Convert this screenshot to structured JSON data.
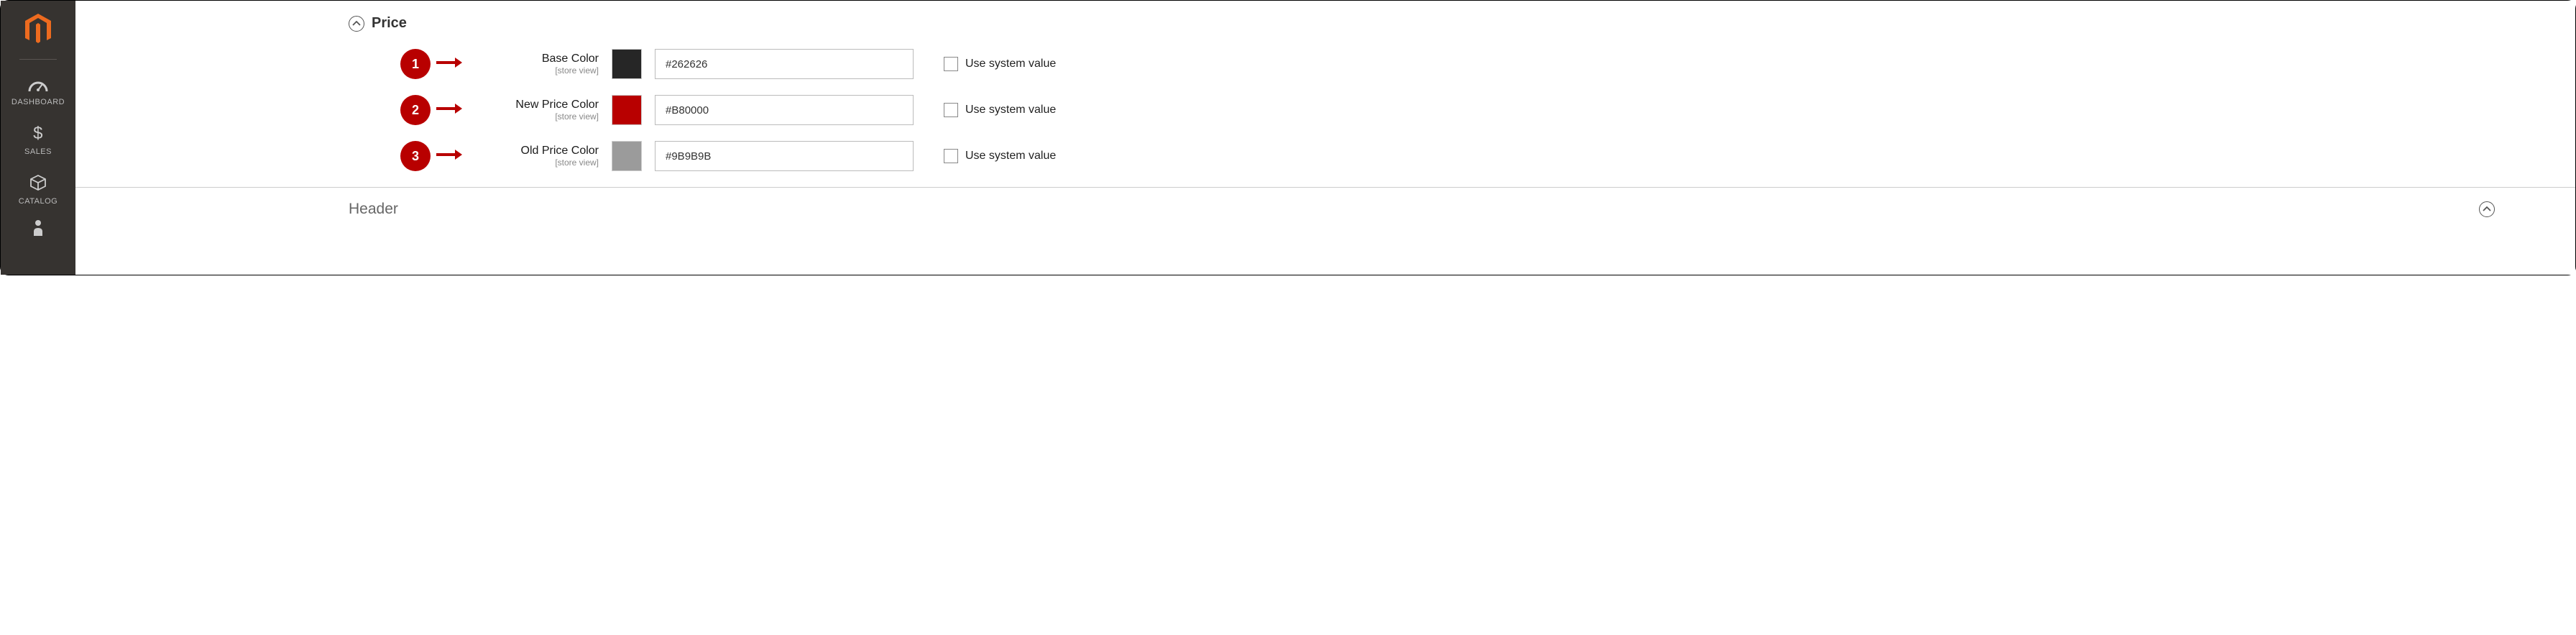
{
  "sidebar": {
    "items": [
      {
        "label": "DASHBOARD",
        "icon": "dashboard"
      },
      {
        "label": "SALES",
        "icon": "dollar"
      },
      {
        "label": "CATALOG",
        "icon": "cube"
      },
      {
        "label": "",
        "icon": "person"
      }
    ]
  },
  "sections": {
    "price": {
      "title": "Price",
      "fields": [
        {
          "num": "1",
          "label": "Base Color",
          "scope": "[store view]",
          "swatch": "#262626",
          "value": "#262626",
          "sysval": "Use system value"
        },
        {
          "num": "2",
          "label": "New Price Color",
          "scope": "[store view]",
          "swatch": "#B80000",
          "value": "#B80000",
          "sysval": "Use system value"
        },
        {
          "num": "3",
          "label": "Old Price Color",
          "scope": "[store view]",
          "swatch": "#9B9B9B",
          "value": "#9B9B9B",
          "sysval": "Use system value"
        }
      ]
    },
    "header": {
      "title": "Header"
    }
  }
}
